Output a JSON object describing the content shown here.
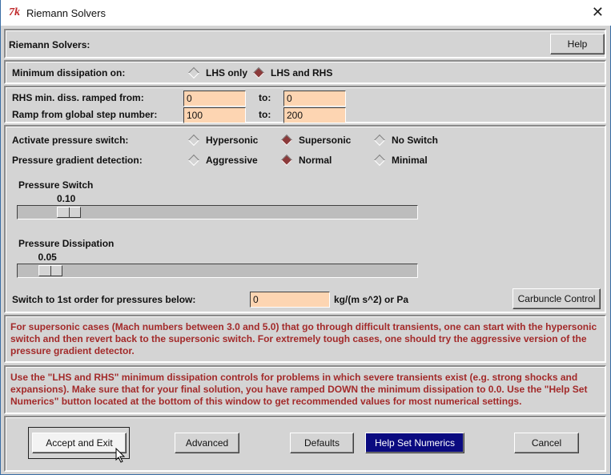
{
  "window": {
    "title": "Riemann Solvers",
    "icon": "tk-icon",
    "close": "✕"
  },
  "header": {
    "label": "Riemann Solvers:",
    "help": "Help"
  },
  "min_diss": {
    "label": "Minimum dissipation on:",
    "options": [
      "LHS only",
      "LHS and RHS"
    ],
    "selected": 1
  },
  "ramp": {
    "rhs_label": "RHS min. diss. ramped from:",
    "rhs_from": "0",
    "to1": "to:",
    "rhs_to": "0",
    "step_label": "Ramp from global step number:",
    "step_from": "100",
    "to2": "to:",
    "step_to": "200"
  },
  "pressure": {
    "switch_label": "Activate pressure switch:",
    "switch_options": [
      "Hypersonic",
      "Supersonic",
      "No Switch"
    ],
    "switch_selected": 1,
    "grad_label": "Pressure gradient detection:",
    "grad_options": [
      "Aggressive",
      "Normal",
      "Minimal"
    ],
    "grad_selected": 1,
    "slider1": {
      "label": "Pressure Switch",
      "value_text": "0.10",
      "value": 0.1,
      "range": [
        0,
        1
      ]
    },
    "slider2": {
      "label": "Pressure Dissipation",
      "value_text": "0.05",
      "value": 0.05,
      "range": [
        0,
        1
      ]
    },
    "first_order_label": "Switch to 1st order for pressures below:",
    "first_order_value": "0",
    "units": "kg/(m s^2) or Pa",
    "carbuncle": "Carbuncle Control"
  },
  "info1": "For supersonic cases (Mach numbers between 3.0 and 5.0) that go through difficult transients, one can start with the hypersonic switch and then revert back to the supersonic switch. For extremely tough cases, one should try the aggressive version of the pressure gradient detector.",
  "info2": "Use the \"LHS and RHS\" minimum dissipation controls for problems in which severe transients exist (e.g. strong shocks and expansions). Make sure that for your final solution, you have ramped DOWN the minimum dissipation to 0.0. Use the \"Help Set Numerics\" button located at the bottom of this window to get recommended values for most numerical settings.",
  "buttons": {
    "accept": "Accept and Exit",
    "advanced": "Advanced",
    "defaults": "Defaults",
    "help_numerics": "Help Set Numerics",
    "cancel": "Cancel"
  },
  "colors": {
    "entry": "#fdd5b2",
    "info_text": "#a32a2a",
    "selected_button": "#0a0a80"
  }
}
